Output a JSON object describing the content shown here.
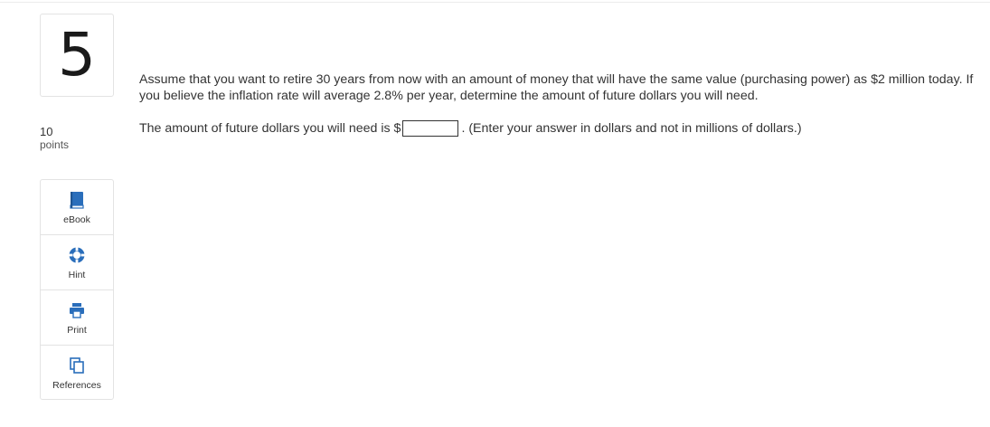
{
  "question": {
    "number": "5",
    "points_value": "10",
    "points_label": "points",
    "text": "Assume that you want to retire 30 years from now with an amount of money that will have the same value (purchasing power) as $2 million today. If you believe the inflation rate will average 2.8% per year, determine the amount of future dollars you will need.",
    "answer_prefix": "The amount of future dollars you will need is $",
    "answer_value": "",
    "answer_suffix": ". (Enter your answer in dollars and not in millions of dollars.)"
  },
  "tools": [
    {
      "label": "eBook",
      "icon": "book-icon"
    },
    {
      "label": "Hint",
      "icon": "lifebuoy-icon"
    },
    {
      "label": "Print",
      "icon": "printer-icon"
    },
    {
      "label": "References",
      "icon": "documents-icon"
    }
  ],
  "colors": {
    "icon_blue": "#2a6ebb",
    "border": "#e3e3e3"
  }
}
